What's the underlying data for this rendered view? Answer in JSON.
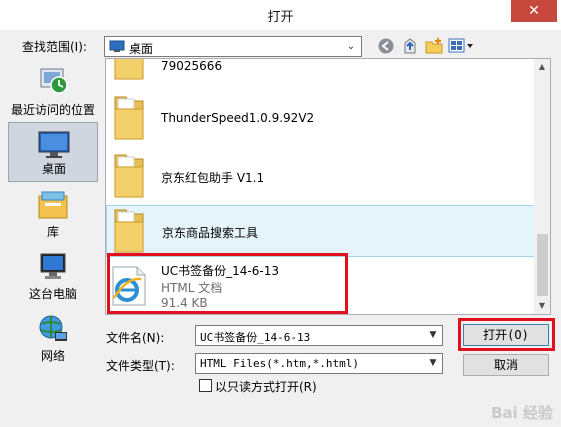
{
  "window": {
    "title": "打开",
    "close_glyph": "✕"
  },
  "lookin": {
    "label": "查找范围(I):",
    "value": "桌面",
    "arrow": "⌄"
  },
  "toolbar": {
    "back_icon": "back-icon",
    "up_icon": "up-folder-icon",
    "new_folder_icon": "new-folder-icon",
    "view_icon": "view-menu-icon"
  },
  "places": [
    {
      "label": "最近访问的位置",
      "icon": "recent-places-icon"
    },
    {
      "label": "桌面",
      "icon": "desktop-icon"
    },
    {
      "label": "库",
      "icon": "libraries-icon"
    },
    {
      "label": "这台电脑",
      "icon": "computer-icon"
    },
    {
      "label": "网络",
      "icon": "network-icon"
    }
  ],
  "files": [
    {
      "name": "79025666",
      "type": "folder"
    },
    {
      "name": "ThunderSpeed1.0.9.92V2",
      "type": "folder"
    },
    {
      "name": "京东红包助手 V1.1",
      "type": "folder"
    },
    {
      "name": "京东商品搜索工具",
      "type": "folder"
    },
    {
      "name": "UC书签备份_14-6-13",
      "type": "html",
      "kind": "HTML 文档",
      "size": "91.4 KB"
    }
  ],
  "filename": {
    "label": "文件名(N):",
    "value": "UC书签备份_14-6-13"
  },
  "filetype": {
    "label": "文件类型(T):",
    "value": "HTML Files(*.htm,*.html)"
  },
  "readonly": {
    "label": "以只读方式打开(R)"
  },
  "buttons": {
    "open": "打开(O)",
    "cancel": "取消"
  },
  "watermark": "Bai 经验",
  "colors": {
    "highlight_red": "#e0101e",
    "selection_blue": "#e5f3fb",
    "close_red": "#c7483c"
  }
}
